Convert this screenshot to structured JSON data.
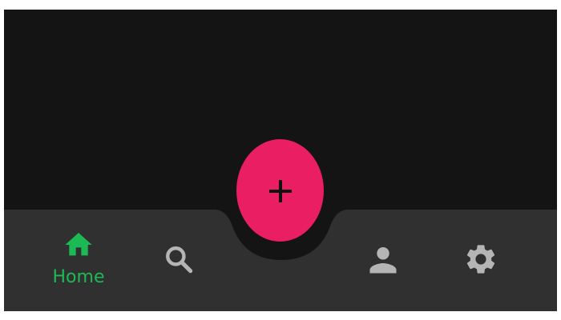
{
  "colors": {
    "background": "#141414",
    "navbar": "#303030",
    "active": "#1db954",
    "inactive": "#b5b5b5",
    "fab": "#e91e63",
    "fab_icon": "#111111"
  },
  "fab": {
    "icon": "plus-icon"
  },
  "nav": {
    "active_item": "home",
    "items": [
      {
        "id": "home",
        "icon": "home-icon",
        "label": "Home"
      },
      {
        "id": "search",
        "icon": "search-icon"
      },
      {
        "id": "profile",
        "icon": "person-icon"
      },
      {
        "id": "settings",
        "icon": "gear-icon"
      }
    ]
  }
}
